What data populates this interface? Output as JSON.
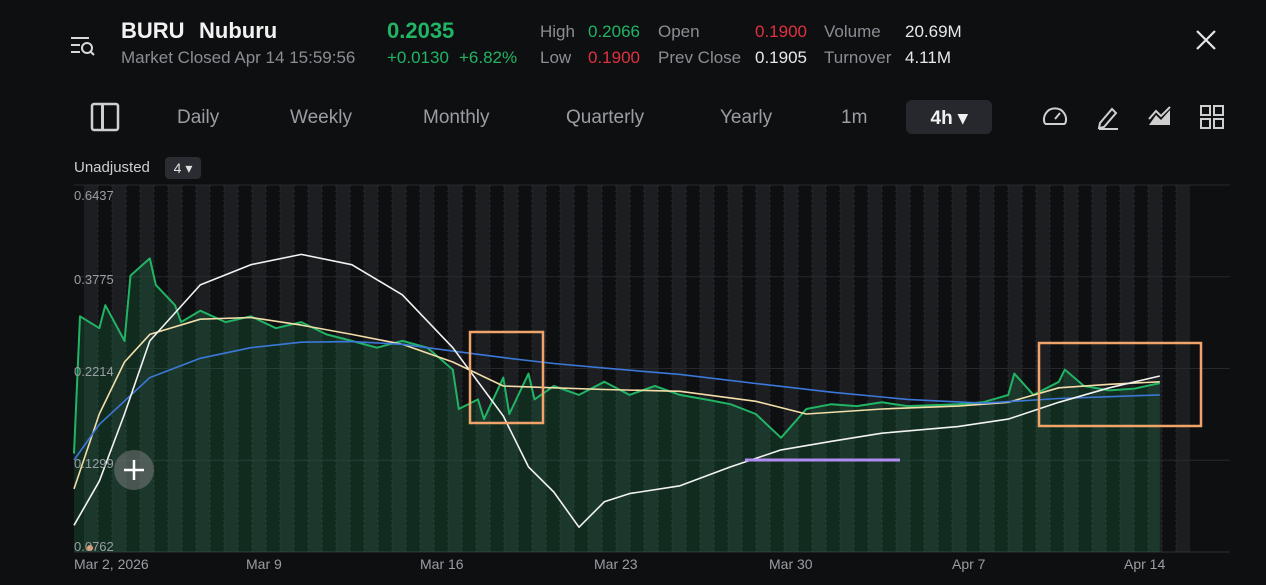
{
  "header": {
    "symbol": "BURU",
    "name": "Nuburu",
    "status": "Market Closed Apr 14 15:59:56",
    "price": "0.2035",
    "change": "+0.0130",
    "change_pct": "+6.82%",
    "high_label": "High",
    "high": "0.2066",
    "low_label": "Low",
    "low": "0.1900",
    "open_label": "Open",
    "open": "0.1900",
    "prev_close_label": "Prev Close",
    "prev_close": "0.1905",
    "volume_label": "Volume",
    "volume": "20.69M",
    "turnover_label": "Turnover",
    "turnover": "4.11M"
  },
  "colors": {
    "up": "#21b464",
    "down": "#e0313f",
    "accent_ma": "#3b78d8",
    "ma_yellow": "#f3deaa",
    "annotation_box": "#f0a46a",
    "annotation_line": "#b18cf0"
  },
  "tabs": {
    "daily": "Daily",
    "weekly": "Weekly",
    "monthly": "Monthly",
    "quarterly": "Quarterly",
    "yearly": "Yearly",
    "one_min": "1m",
    "active": "4h ▾"
  },
  "icons": [
    "sidebar-toggle-icon",
    "menu-search-icon",
    "close-icon",
    "gauge-icon",
    "pen-icon",
    "indicator-icon",
    "grid-icon",
    "plus-icon",
    "caret-down-icon"
  ],
  "chart_opts": {
    "adjust_label": "Unadjusted",
    "count_label": "4 ▾"
  },
  "chart_data": {
    "type": "area",
    "scale": "log",
    "ylim": [
      0.0762,
      0.6437
    ],
    "y_ticks": [
      "0.6437",
      "0.3775",
      "0.2214",
      "0.1299",
      "0.0762"
    ],
    "x_ticks": [
      "Mar 2, 2026",
      "Mar 9",
      "Mar 16",
      "Mar 23",
      "Mar 30",
      "Apr 7",
      "Apr 14"
    ],
    "x_tick_dates": [
      "2026-03-02",
      "2026-03-09",
      "2026-03-16",
      "2026-03-23",
      "2026-03-30",
      "2026-04-07",
      "2026-04-14"
    ],
    "series": [
      {
        "color": "#21b464",
        "fill": true,
        "points": [
          [
            "2026-03-02",
            0.135
          ],
          [
            "2026-03-02",
            0.3
          ],
          [
            "2026-03-03",
            0.28
          ],
          [
            "2026-03-03",
            0.32
          ],
          [
            "2026-03-04",
            0.26
          ],
          [
            "2026-03-04",
            0.38
          ],
          [
            "2026-03-05",
            0.42
          ],
          [
            "2026-03-05",
            0.36
          ],
          [
            "2026-03-06",
            0.32
          ],
          [
            "2026-03-06",
            0.29
          ],
          [
            "2026-03-07",
            0.31
          ],
          [
            "2026-03-08",
            0.29
          ],
          [
            "2026-03-09",
            0.3
          ],
          [
            "2026-03-10",
            0.28
          ],
          [
            "2026-03-11",
            0.29
          ],
          [
            "2026-03-12",
            0.27
          ],
          [
            "2026-03-13",
            0.26
          ],
          [
            "2026-03-14",
            0.25
          ],
          [
            "2026-03-15",
            0.26
          ],
          [
            "2026-03-16",
            0.25
          ],
          [
            "2026-03-17",
            0.22
          ],
          [
            "2026-03-17",
            0.175
          ],
          [
            "2026-03-18",
            0.185
          ],
          [
            "2026-03-18",
            0.165
          ],
          [
            "2026-03-19",
            0.21
          ],
          [
            "2026-03-19",
            0.17
          ],
          [
            "2026-03-20",
            0.215
          ],
          [
            "2026-03-20",
            0.185
          ],
          [
            "2026-03-21",
            0.2
          ],
          [
            "2026-03-22",
            0.19
          ],
          [
            "2026-03-23",
            0.205
          ],
          [
            "2026-03-24",
            0.19
          ],
          [
            "2026-03-25",
            0.2
          ],
          [
            "2026-03-26",
            0.19
          ],
          [
            "2026-03-27",
            0.185
          ],
          [
            "2026-03-28",
            0.18
          ],
          [
            "2026-03-29",
            0.17
          ],
          [
            "2026-03-30",
            0.148
          ],
          [
            "2026-03-31",
            0.175
          ],
          [
            "2026-04-01",
            0.18
          ],
          [
            "2026-04-02",
            0.178
          ],
          [
            "2026-04-03",
            0.182
          ],
          [
            "2026-04-04",
            0.178
          ],
          [
            "2026-04-06",
            0.18
          ],
          [
            "2026-04-07",
            0.182
          ],
          [
            "2026-04-08",
            0.19
          ],
          [
            "2026-04-08",
            0.215
          ],
          [
            "2026-04-09",
            0.19
          ],
          [
            "2026-04-10",
            0.205
          ],
          [
            "2026-04-10",
            0.22
          ],
          [
            "2026-04-11",
            0.2
          ],
          [
            "2026-04-12",
            0.195
          ],
          [
            "2026-04-13",
            0.197
          ],
          [
            "2026-04-14",
            0.2035
          ]
        ]
      },
      {
        "color": "#f3deaa",
        "points": [
          [
            "2026-03-02",
            0.11
          ],
          [
            "2026-03-03",
            0.17
          ],
          [
            "2026-03-04",
            0.23
          ],
          [
            "2026-03-05",
            0.27
          ],
          [
            "2026-03-07",
            0.295
          ],
          [
            "2026-03-09",
            0.298
          ],
          [
            "2026-03-11",
            0.285
          ],
          [
            "2026-03-13",
            0.27
          ],
          [
            "2026-03-15",
            0.255
          ],
          [
            "2026-03-17",
            0.23
          ],
          [
            "2026-03-19",
            0.2
          ],
          [
            "2026-03-21",
            0.198
          ],
          [
            "2026-03-23",
            0.196
          ],
          [
            "2026-03-26",
            0.194
          ],
          [
            "2026-03-29",
            0.183
          ],
          [
            "2026-03-31",
            0.17
          ],
          [
            "2026-04-03",
            0.175
          ],
          [
            "2026-04-06",
            0.178
          ],
          [
            "2026-04-08",
            0.182
          ],
          [
            "2026-04-10",
            0.198
          ],
          [
            "2026-04-12",
            0.202
          ],
          [
            "2026-04-14",
            0.205
          ]
        ]
      },
      {
        "color": "#3b78d8",
        "points": [
          [
            "2026-03-02",
            0.13
          ],
          [
            "2026-03-03",
            0.16
          ],
          [
            "2026-03-05",
            0.21
          ],
          [
            "2026-03-07",
            0.235
          ],
          [
            "2026-03-09",
            0.25
          ],
          [
            "2026-03-11",
            0.258
          ],
          [
            "2026-03-13",
            0.259
          ],
          [
            "2026-03-15",
            0.255
          ],
          [
            "2026-03-17",
            0.245
          ],
          [
            "2026-03-19",
            0.236
          ],
          [
            "2026-03-21",
            0.228
          ],
          [
            "2026-03-23",
            0.222
          ],
          [
            "2026-03-26",
            0.214
          ],
          [
            "2026-03-29",
            0.203
          ],
          [
            "2026-04-01",
            0.193
          ],
          [
            "2026-04-04",
            0.185
          ],
          [
            "2026-04-07",
            0.181
          ],
          [
            "2026-04-10",
            0.186
          ],
          [
            "2026-04-12",
            0.188
          ],
          [
            "2026-04-14",
            0.19
          ]
        ]
      },
      {
        "color": "#f2f2f2",
        "points": [
          [
            "2026-03-02",
            0.089
          ],
          [
            "2026-03-03",
            0.115
          ],
          [
            "2026-03-04",
            0.17
          ],
          [
            "2026-03-05",
            0.26
          ],
          [
            "2026-03-07",
            0.36
          ],
          [
            "2026-03-09",
            0.405
          ],
          [
            "2026-03-11",
            0.43
          ],
          [
            "2026-03-13",
            0.405
          ],
          [
            "2026-03-15",
            0.34
          ],
          [
            "2026-03-17",
            0.25
          ],
          [
            "2026-03-19",
            0.168
          ],
          [
            "2026-03-20",
            0.125
          ],
          [
            "2026-03-21",
            0.108
          ],
          [
            "2026-03-22",
            0.088
          ],
          [
            "2026-03-23",
            0.102
          ],
          [
            "2026-03-24",
            0.107
          ],
          [
            "2026-03-26",
            0.112
          ],
          [
            "2026-03-28",
            0.125
          ],
          [
            "2026-03-30",
            0.138
          ],
          [
            "2026-04-01",
            0.145
          ],
          [
            "2026-04-03",
            0.152
          ],
          [
            "2026-04-06",
            0.158
          ],
          [
            "2026-04-08",
            0.165
          ],
          [
            "2026-04-10",
            0.182
          ],
          [
            "2026-04-12",
            0.198
          ],
          [
            "2026-04-14",
            0.212
          ]
        ]
      }
    ]
  }
}
